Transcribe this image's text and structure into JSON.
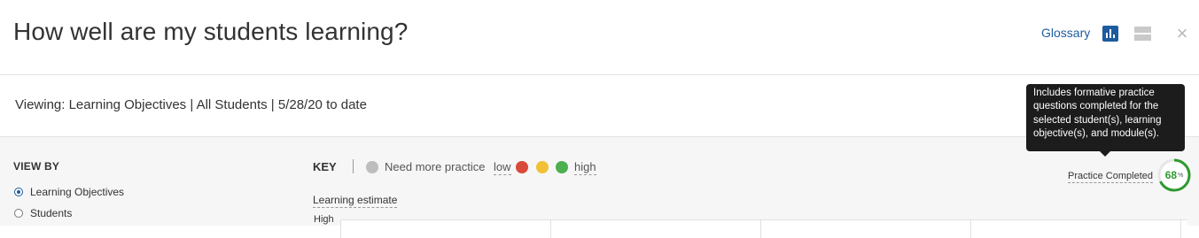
{
  "header": {
    "title": "How well are my students learning?",
    "glossary_label": "Glossary"
  },
  "viewing": {
    "text": "Viewing: Learning Objectives | All Students | 5/28/20 to date"
  },
  "view_by": {
    "title": "VIEW BY",
    "options": [
      {
        "label": "Learning Objectives",
        "selected": true
      },
      {
        "label": "Students",
        "selected": false
      }
    ]
  },
  "key": {
    "title": "KEY",
    "need_more_practice": "Need more practice",
    "low": "low",
    "high": "high",
    "colors": {
      "need_more_practice": "#bdbdbd",
      "low": "#d94a3a",
      "mid": "#f2c035",
      "high": "#4caf50"
    }
  },
  "chart": {
    "estimate_label": "Learning estimate",
    "y_top_label": "High"
  },
  "practice": {
    "label": "Practice Completed",
    "percent": 68,
    "percent_text": "68",
    "unit": "%",
    "ring_color": "#2e9a2e"
  },
  "tooltip": {
    "lines": [
      "Includes formative practice",
      "questions completed for the",
      "selected student(s), learning",
      "objective(s), and module(s)."
    ]
  },
  "icons": {
    "chart_view": "bar-chart-icon",
    "table_view": "table-icon",
    "close": "close-icon"
  }
}
